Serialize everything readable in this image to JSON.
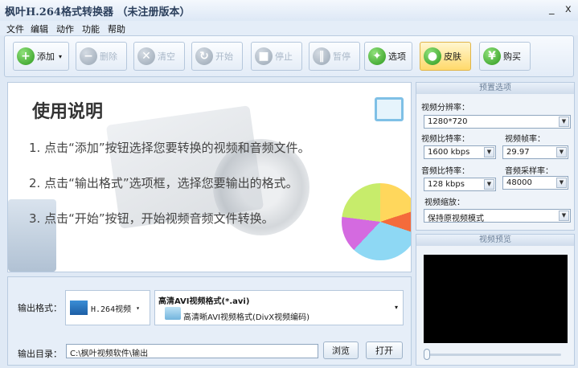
{
  "app": {
    "title": "枫叶H.264格式转换器 （未注册版本）",
    "minimize": "_",
    "close": "x"
  },
  "menu": [
    "文件",
    "编辑",
    "动作",
    "功能",
    "帮助"
  ],
  "toolbar": {
    "add": "添加",
    "delete": "删除",
    "clear": "清空",
    "start": "开始",
    "stop": "停止",
    "pause": "暂停",
    "options": "选项",
    "skin": "皮肤",
    "buy": "购买"
  },
  "instructions": {
    "heading": "使用说明",
    "steps": [
      "1. 点击“添加”按钮选择您要转换的视频和音频文件。",
      "2. 点击“输出格式”选项框，选择您要输出的格式。",
      "3. 点击“开始”按钮，开始视频音频文件转换。"
    ]
  },
  "output": {
    "format_label": "输出格式：",
    "format_value": "H.264视频",
    "format_title": "高清AVI视频格式(*.avi)",
    "format_desc": "高清晰AVI视频格式(DivX视频编码)",
    "dir_label": "输出目录：",
    "dir_value": "C:\\枫叶视频软件\\输出",
    "browse": "浏览",
    "open": "打开"
  },
  "preset": {
    "header": "预置选项",
    "resolution_label": "视频分辨率：",
    "resolution": "1280*720",
    "vbitrate_label": "视频比特率：",
    "vbitrate": "1600 kbps",
    "framerate_label": "视频帧率：",
    "framerate": "29.97",
    "abitrate_label": "音频比特率：",
    "abitrate": "128 kbps",
    "samplerate_label": "音频采样率：",
    "samplerate": "48000",
    "scale_label": "视频缩放：",
    "scale": "保持原视频模式"
  },
  "preview": {
    "header": "视频预览"
  }
}
